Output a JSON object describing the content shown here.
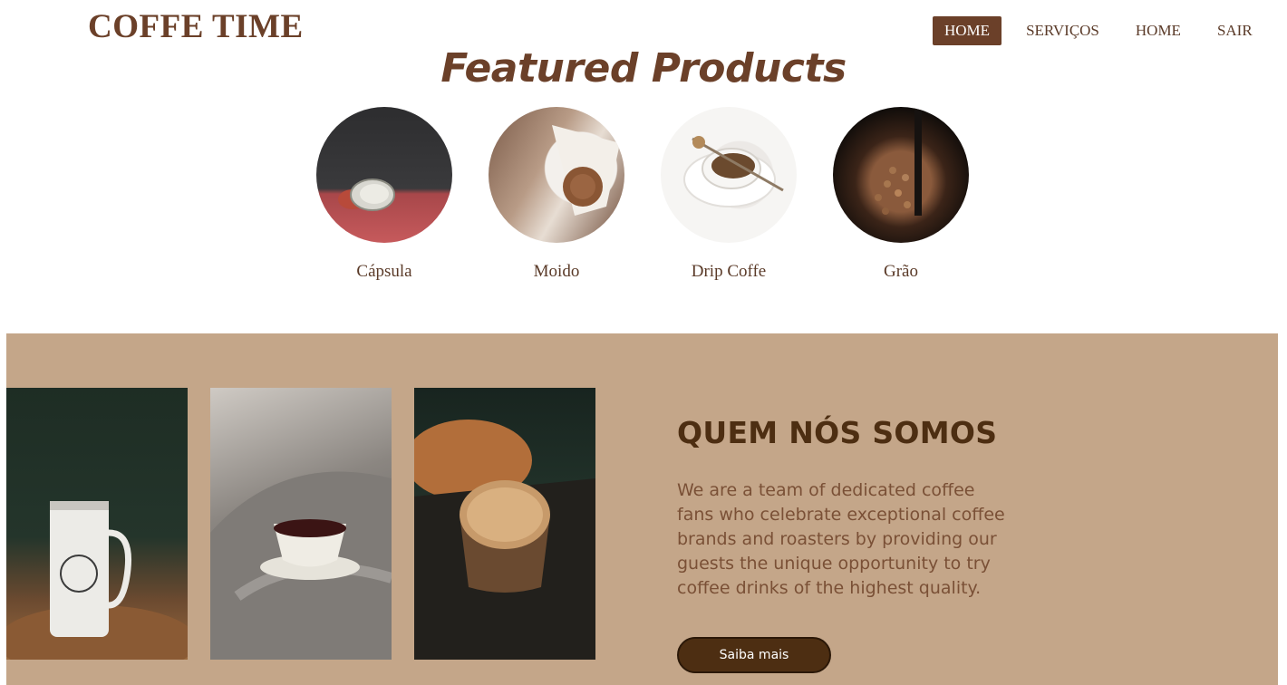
{
  "header": {
    "brand": "COFFE TIME",
    "nav": [
      "HOME",
      "SERVIÇOS",
      "HOME",
      "SAIR"
    ],
    "active_index": 0
  },
  "featured": {
    "title": "Featured Products",
    "products": [
      {
        "label": "Cápsula",
        "image": "coffee-capsule-photo"
      },
      {
        "label": "Moido",
        "image": "ground-coffee-filter-photo"
      },
      {
        "label": "Drip Coffe",
        "image": "drip-coffee-cup-photo"
      },
      {
        "label": "Grão",
        "image": "coffee-beans-photo"
      }
    ]
  },
  "about": {
    "photos": [
      "coffee-mug-photo",
      "tea-cup-blanket-photo",
      "latte-cup-photo"
    ],
    "title": "QUEM NÓS SOMOS",
    "text": "We are a team of dedicated coffee fans who celebrate exceptional coffee brands and roasters by providing our guests the unique opportunity to try coffee drinks of the highest quality.",
    "button": "Saiba mais"
  },
  "colors": {
    "brand": "#6b4029",
    "section_bg": "#c4a689",
    "button_bg": "#4d2e12"
  }
}
